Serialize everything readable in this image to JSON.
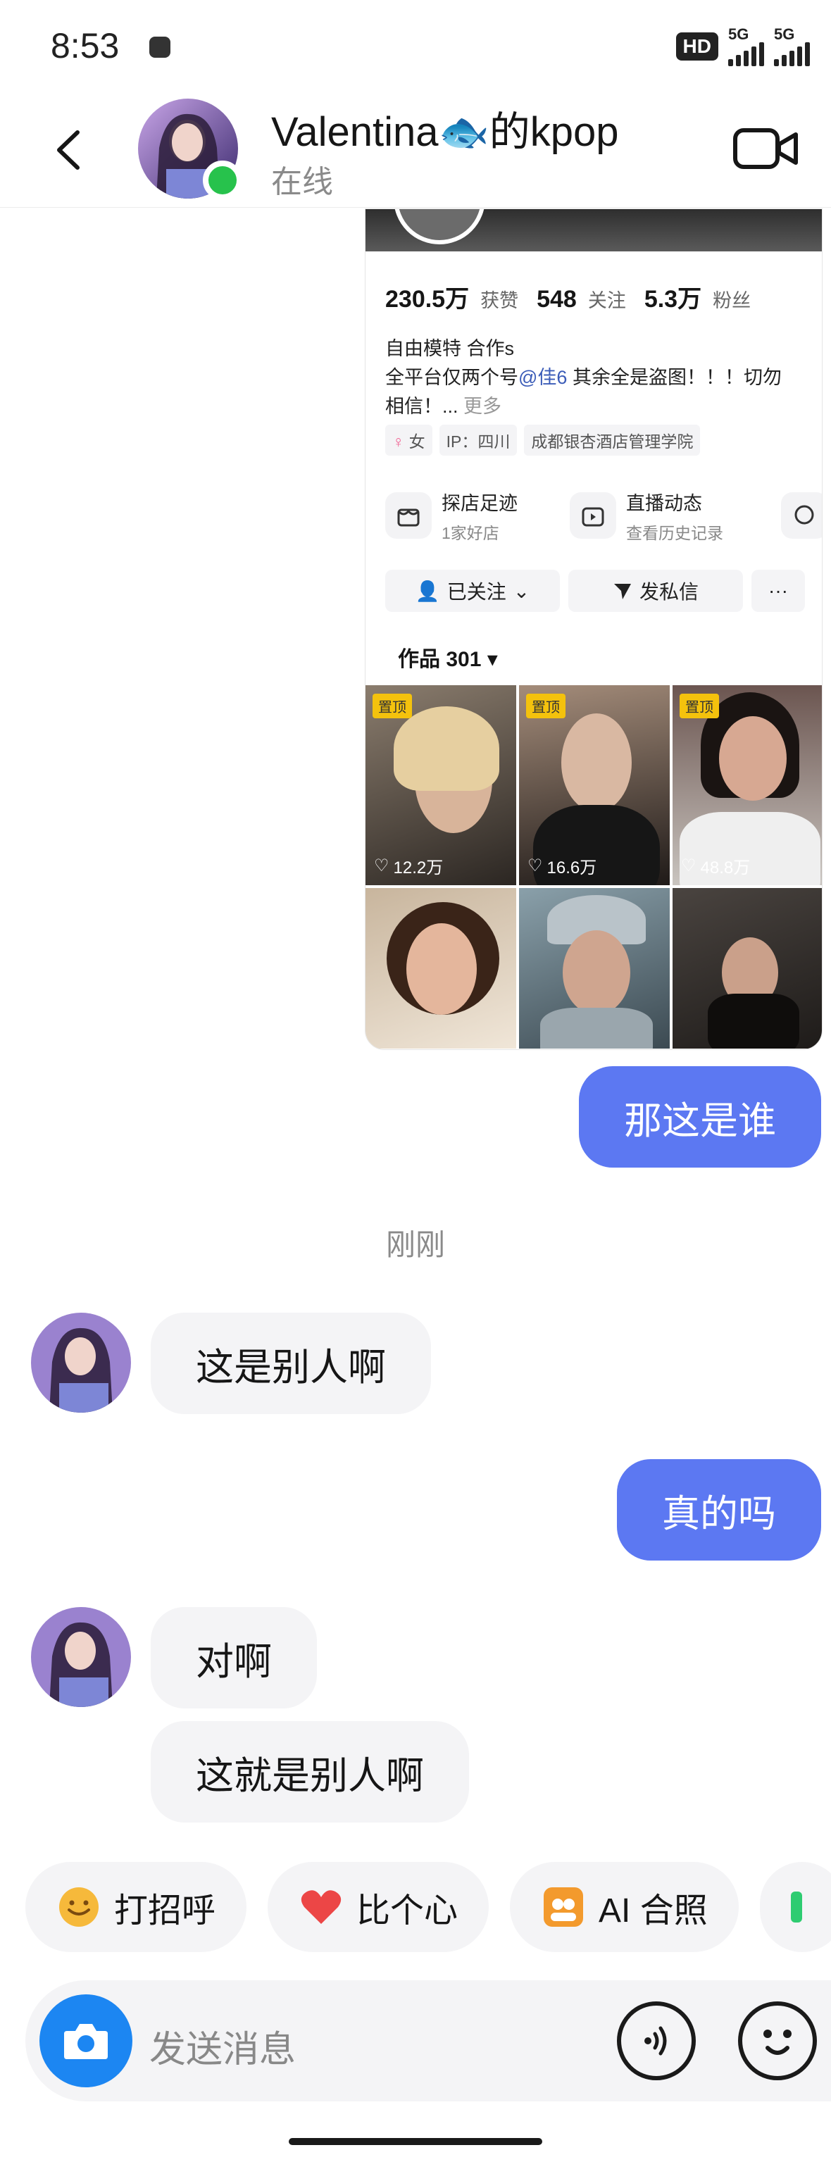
{
  "status_bar": {
    "time": "8:53",
    "hd": "HD",
    "signal_1": "5G",
    "signal_2": "5G"
  },
  "header": {
    "name": "Valentina🐟的kpop",
    "status": "在线",
    "colors": {
      "online": "#27c24c"
    }
  },
  "shared_card": {
    "stats": [
      {
        "value": "230.5万",
        "label": "获赞"
      },
      {
        "value": "548",
        "label": "关注"
      },
      {
        "value": "5.3万",
        "label": "粉丝"
      }
    ],
    "bio_line1": "自由模特 合作s",
    "bio_line2_pre": "全平台仅两个号",
    "bio_line2_mention": "@佳6",
    "bio_line2_post": "  其余全是盗图！！！切勿",
    "bio_line3": "相信！... ",
    "bio_more": "更多",
    "tags": {
      "gender": "女",
      "ip": "IP：四川",
      "school": "成都银杏酒店管理学院"
    },
    "features": [
      {
        "title": "探店足迹",
        "sub": "1家好店",
        "icon": "shop-icon"
      },
      {
        "title": "直播动态",
        "sub": "查看历史记录",
        "icon": "tv-icon"
      }
    ],
    "buttons": {
      "follow": "已关注",
      "message": "发私信",
      "more": "···"
    },
    "works_label": "作品 301 ▾",
    "pinned_label": "置顶",
    "thumb_likes": [
      "12.2万",
      "16.6万",
      "48.8万"
    ]
  },
  "messages": {
    "me_1": "那这是谁",
    "timestamp": "刚刚",
    "them_1": "这是别人啊",
    "me_2": "真的吗",
    "them_2": "对啊",
    "them_3": "这就是别人啊"
  },
  "quick_actions": [
    {
      "label": "打招呼",
      "icon": "wave-emoji-icon"
    },
    {
      "label": "比个心",
      "icon": "heart-icon"
    },
    {
      "label": "AI 合照",
      "icon": "ai-photo-icon"
    }
  ],
  "input": {
    "placeholder": "发送消息"
  },
  "colors": {
    "my_bubble": "#5c78f2",
    "their_bubble": "#f4f4f6",
    "camera_button": "#1c86f2"
  }
}
